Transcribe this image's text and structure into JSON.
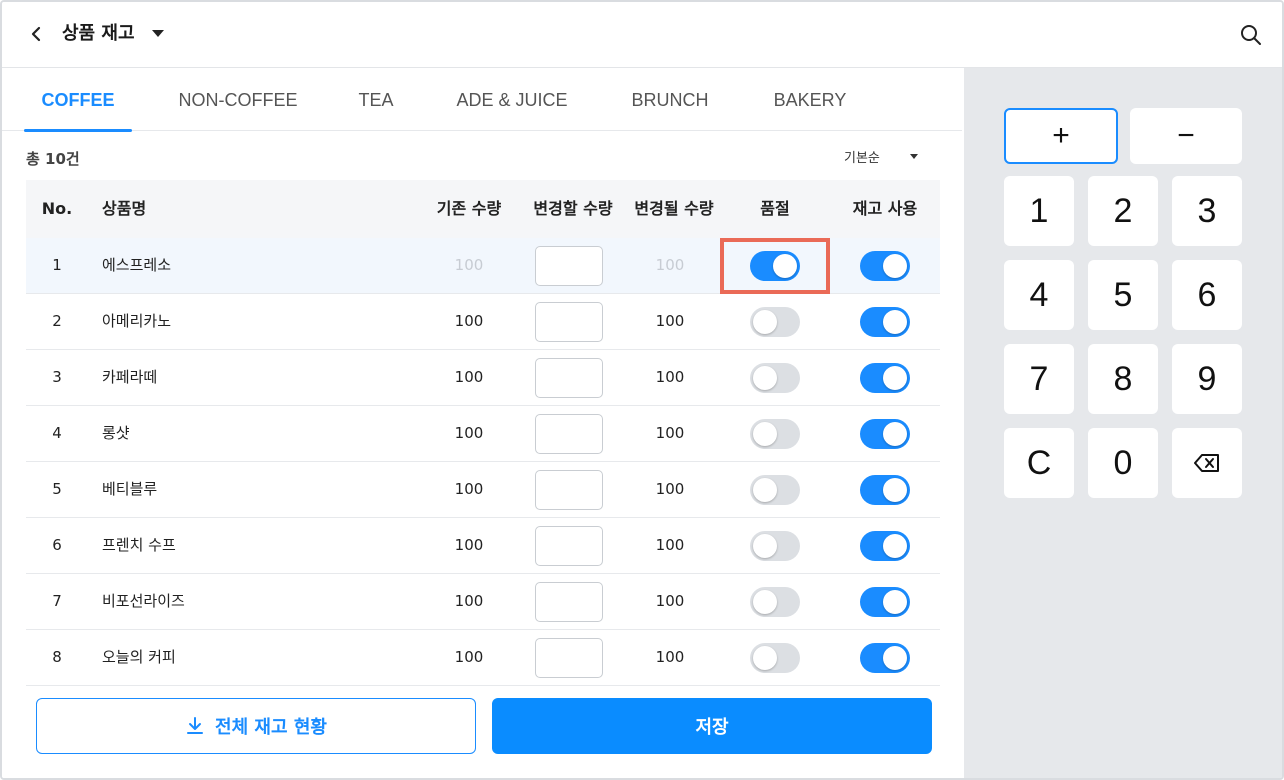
{
  "header": {
    "title": "상품 재고"
  },
  "tabs": [
    {
      "label": "COFFEE",
      "active": true
    },
    {
      "label": "NON-COFFEE",
      "active": false
    },
    {
      "label": "TEA",
      "active": false
    },
    {
      "label": "ADE & JUICE",
      "active": false
    },
    {
      "label": "BRUNCH",
      "active": false
    },
    {
      "label": "BAKERY",
      "active": false
    }
  ],
  "list": {
    "total": "총 10건",
    "sort_label": "기본순"
  },
  "table": {
    "headers": {
      "no": "No.",
      "name": "상품명",
      "current": "기존 수량",
      "change": "변경할 수량",
      "new": "변경될 수량",
      "soldout": "품절",
      "stock": "재고 사용"
    },
    "rows": [
      {
        "no": "1",
        "name": "에스프레소",
        "current": "100",
        "change": "",
        "new": "100",
        "soldout": true,
        "stock": true
      },
      {
        "no": "2",
        "name": "아메리카노",
        "current": "100",
        "change": "",
        "new": "100",
        "soldout": false,
        "stock": true
      },
      {
        "no": "3",
        "name": "카페라떼",
        "current": "100",
        "change": "",
        "new": "100",
        "soldout": false,
        "stock": true
      },
      {
        "no": "4",
        "name": "롱샷",
        "current": "100",
        "change": "",
        "new": "100",
        "soldout": false,
        "stock": true
      },
      {
        "no": "5",
        "name": "베티블루",
        "current": "100",
        "change": "",
        "new": "100",
        "soldout": false,
        "stock": true
      },
      {
        "no": "6",
        "name": "프렌치 수프",
        "current": "100",
        "change": "",
        "new": "100",
        "soldout": false,
        "stock": true
      },
      {
        "no": "7",
        "name": "비포선라이즈",
        "current": "100",
        "change": "",
        "new": "100",
        "soldout": false,
        "stock": true
      },
      {
        "no": "8",
        "name": "오늘의 커피",
        "current": "100",
        "change": "",
        "new": "100",
        "soldout": false,
        "stock": true
      }
    ]
  },
  "actions": {
    "download_label": "전체 재고 현황",
    "save_label": "저장"
  },
  "keypad": {
    "plus": "+",
    "minus": "−",
    "keys": [
      "1",
      "2",
      "3",
      "4",
      "5",
      "6",
      "7",
      "8",
      "9",
      "C",
      "0"
    ]
  },
  "colors": {
    "accent": "#1a8cff",
    "highlight_border": "#ea6a57",
    "toggle_off": "#dcdfe3",
    "keypad_bg": "#e6e8eb"
  }
}
